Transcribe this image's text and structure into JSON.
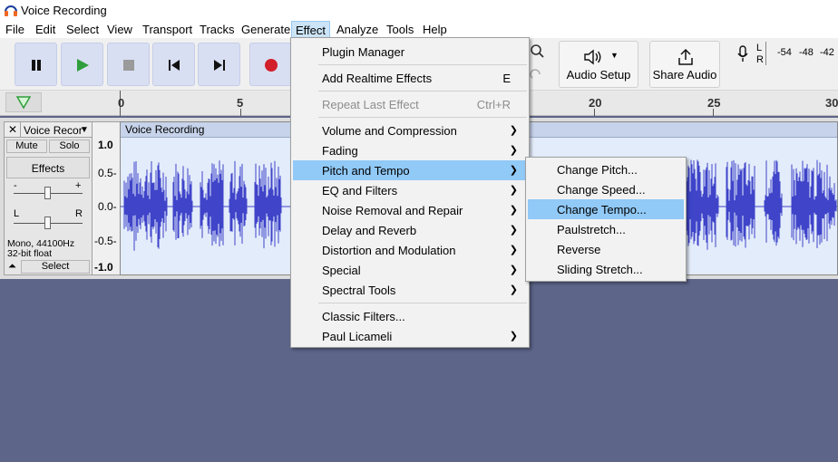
{
  "window": {
    "title": "Voice Recording",
    "app_icon": "headphones-icon"
  },
  "menubar": [
    {
      "label": "File"
    },
    {
      "label": "Edit"
    },
    {
      "label": "Select"
    },
    {
      "label": "View"
    },
    {
      "label": "Transport"
    },
    {
      "label": "Tracks"
    },
    {
      "label": "Generate"
    },
    {
      "label": "Effect",
      "active": true
    },
    {
      "label": "Analyze"
    },
    {
      "label": "Tools"
    },
    {
      "label": "Help"
    }
  ],
  "toolbar": {
    "transport": [
      "pause-icon",
      "play-icon",
      "stop-icon",
      "skip-start-icon",
      "skip-end-icon",
      "record-icon"
    ],
    "audio_setup": "Audio Setup",
    "share_audio": "Share Audio",
    "meter_ticks": [
      "L",
      "R",
      "-54",
      "-48",
      "-42"
    ]
  },
  "timeline": {
    "ticks": [
      "0",
      "5",
      "20",
      "25",
      "30"
    ]
  },
  "track": {
    "name": "Voice Recor",
    "close": "✕",
    "mute": "Mute",
    "solo": "Solo",
    "effects": "Effects",
    "gain_min": "-",
    "gain_max": "+",
    "pan_left": "L",
    "pan_right": "R",
    "info_line1": "Mono, 44100Hz",
    "info_line2": "32-bit float",
    "select": "Select",
    "clip_name": "Voice Recording",
    "ruler": [
      "1.0",
      "0.5-",
      "0.0-",
      "-0.5-",
      "-1.0"
    ]
  },
  "effect_menu": {
    "items": [
      {
        "label": "Plugin Manager"
      },
      {
        "separator": true
      },
      {
        "label": "Add Realtime Effects",
        "shortcut": "E"
      },
      {
        "separator": true
      },
      {
        "label": "Repeat Last Effect",
        "shortcut": "Ctrl+R",
        "disabled": true
      },
      {
        "separator": true
      },
      {
        "label": "Volume and Compression",
        "submenu": true
      },
      {
        "label": "Fading",
        "submenu": true
      },
      {
        "label": "Pitch and Tempo",
        "submenu": true,
        "highlighted": true
      },
      {
        "label": "EQ and Filters",
        "submenu": true
      },
      {
        "label": "Noise Removal and Repair",
        "submenu": true
      },
      {
        "label": "Delay and Reverb",
        "submenu": true
      },
      {
        "label": "Distortion and Modulation",
        "submenu": true
      },
      {
        "label": "Special",
        "submenu": true
      },
      {
        "label": "Spectral Tools",
        "submenu": true
      },
      {
        "separator": true
      },
      {
        "label": "Classic Filters..."
      },
      {
        "label": "Paul Licameli",
        "submenu": true
      }
    ]
  },
  "pitch_submenu": {
    "items": [
      {
        "label": "Change Pitch..."
      },
      {
        "label": "Change Speed..."
      },
      {
        "label": "Change Tempo...",
        "highlighted": true
      },
      {
        "label": "Paulstretch..."
      },
      {
        "label": "Reverse"
      },
      {
        "label": "Sliding Stretch..."
      }
    ]
  },
  "colors": {
    "waveform": "#3f44c9",
    "highlight": "#91c9f7",
    "background": "#5d6589"
  }
}
